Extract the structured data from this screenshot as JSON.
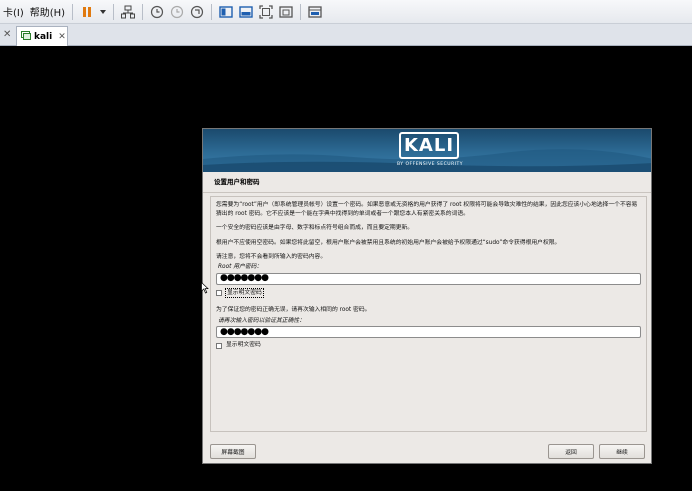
{
  "toolbar": {
    "menu_card": "卡(I)",
    "menu_help": "帮助(H)"
  },
  "tabs": [
    {
      "label": "kali"
    }
  ],
  "installer": {
    "logo": "KALI",
    "logo_sub": "BY OFFENSIVE SECURITY",
    "section_title": "设置用户和密码",
    "para1": "您需要为“root”用户（即系统管理员帐号）设置一个密码。如果恶意或无资格的用户获得了 root 权限将可能会导致灾难性的结果，因此您应该小心地选择一个不容易猜出的 root 密码。它不应该是一个能在字典中找得到的单词或者一个跟您本人有紧密关系的词语。",
    "para2": "一个安全的密码应该是由字母、数字和标点符号组合而成，而且要定期更新。",
    "para3": "根用户不应使用空密码。如果您将此留空，根用户账户会被禁用且系统的初始用户账户会被给予权限通过“sudo”命令获得根用户权限。",
    "para4": "请注意，您将不会看到所输入的密码内容。",
    "root_pw_label": "Root 用户密码：",
    "root_pw_value": "●●●●●●●",
    "show_pw_label": "显示明文密码",
    "para5": "为了保证您的密码正确无误，请再次输入相同的 root 密码。",
    "confirm_pw_label": "请再次输入密码以验证其正确性：",
    "confirm_pw_value": "●●●●●●●",
    "show_pw_label2": "显示明文密码",
    "screenshot_btn": "屏幕截图",
    "back_btn": "返回",
    "continue_btn": "继续"
  },
  "colors": {
    "banner": "#2d6b95",
    "dialog_bg": "#ece9e6",
    "pause_icon": "#e07a10",
    "view_icon_active": "#1e5fb0"
  }
}
